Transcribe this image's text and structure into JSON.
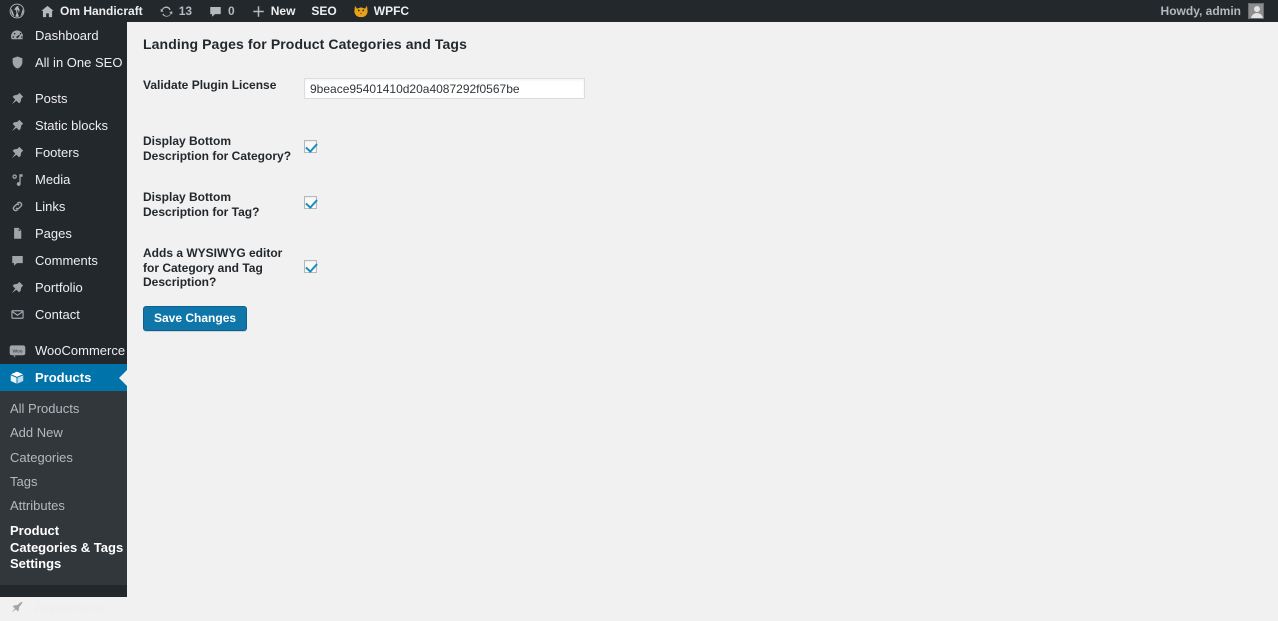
{
  "adminbar": {
    "logo_icon": "wordpress-logo-icon",
    "site_name": "Om Handicraft",
    "site_icon": "home-icon",
    "updates_icon": "updates-icon",
    "updates_count": "13",
    "comments_icon": "comment-bubble-icon",
    "comments_count": "0",
    "new_icon": "plus-icon",
    "new_label": "New",
    "seo_label": "SEO",
    "wpfc_icon": "wpfc-tiger-icon",
    "wpfc_label": "WPFC",
    "howdy": "Howdy, admin",
    "avatar": "user-avatar"
  },
  "sidebar": {
    "items": [
      {
        "label": "Dashboard",
        "icon": "dashboard-icon",
        "current": false
      },
      {
        "label": "All in One SEO",
        "icon": "shield-icon",
        "current": false
      },
      {
        "label": "Posts",
        "icon": "pin-icon",
        "current": false
      },
      {
        "label": "Static blocks",
        "icon": "pin-icon",
        "current": false
      },
      {
        "label": "Footers",
        "icon": "pin-icon",
        "current": false
      },
      {
        "label": "Media",
        "icon": "media-icon",
        "current": false
      },
      {
        "label": "Links",
        "icon": "link-icon",
        "current": false
      },
      {
        "label": "Pages",
        "icon": "pages-icon",
        "current": false
      },
      {
        "label": "Comments",
        "icon": "comment-bubble-icon",
        "current": false
      },
      {
        "label": "Portfolio",
        "icon": "pin-icon",
        "current": false
      },
      {
        "label": "Contact",
        "icon": "envelope-icon",
        "current": false
      },
      {
        "label": "WooCommerce",
        "icon": "woocommerce-icon",
        "current": false
      },
      {
        "label": "Products",
        "icon": "products-box-icon",
        "current": true
      },
      {
        "label": "Appearance",
        "icon": "brush-icon",
        "current": false
      }
    ],
    "submenu": [
      {
        "label": "All Products",
        "current": false
      },
      {
        "label": "Add New",
        "current": false
      },
      {
        "label": "Categories",
        "current": false
      },
      {
        "label": "Tags",
        "current": false
      },
      {
        "label": "Attributes",
        "current": false
      },
      {
        "label": "Product Categories & Tags Settings",
        "current": true
      }
    ]
  },
  "main": {
    "page_title": "Landing Pages for Product Categories and Tags",
    "fields": {
      "license_label": "Validate Plugin License",
      "license_value": "9beace95401410d20a4087292f0567be",
      "bottom_desc_category_label": "Display Bottom Description for Category?",
      "bottom_desc_tag_label": "Display Bottom Description for Tag?",
      "wysiwyg_label": "Adds a WYSIWYG editor for Category and Tag Description?"
    },
    "save_label": "Save Changes"
  },
  "colors": {
    "admin_bar": "#23282d",
    "sidebar": "#23282d",
    "submenu": "#32373c",
    "accent": "#0073aa",
    "button": "#0e76a8",
    "content_bg": "#f1f1f1",
    "checkmark": "#1e8cbe"
  }
}
